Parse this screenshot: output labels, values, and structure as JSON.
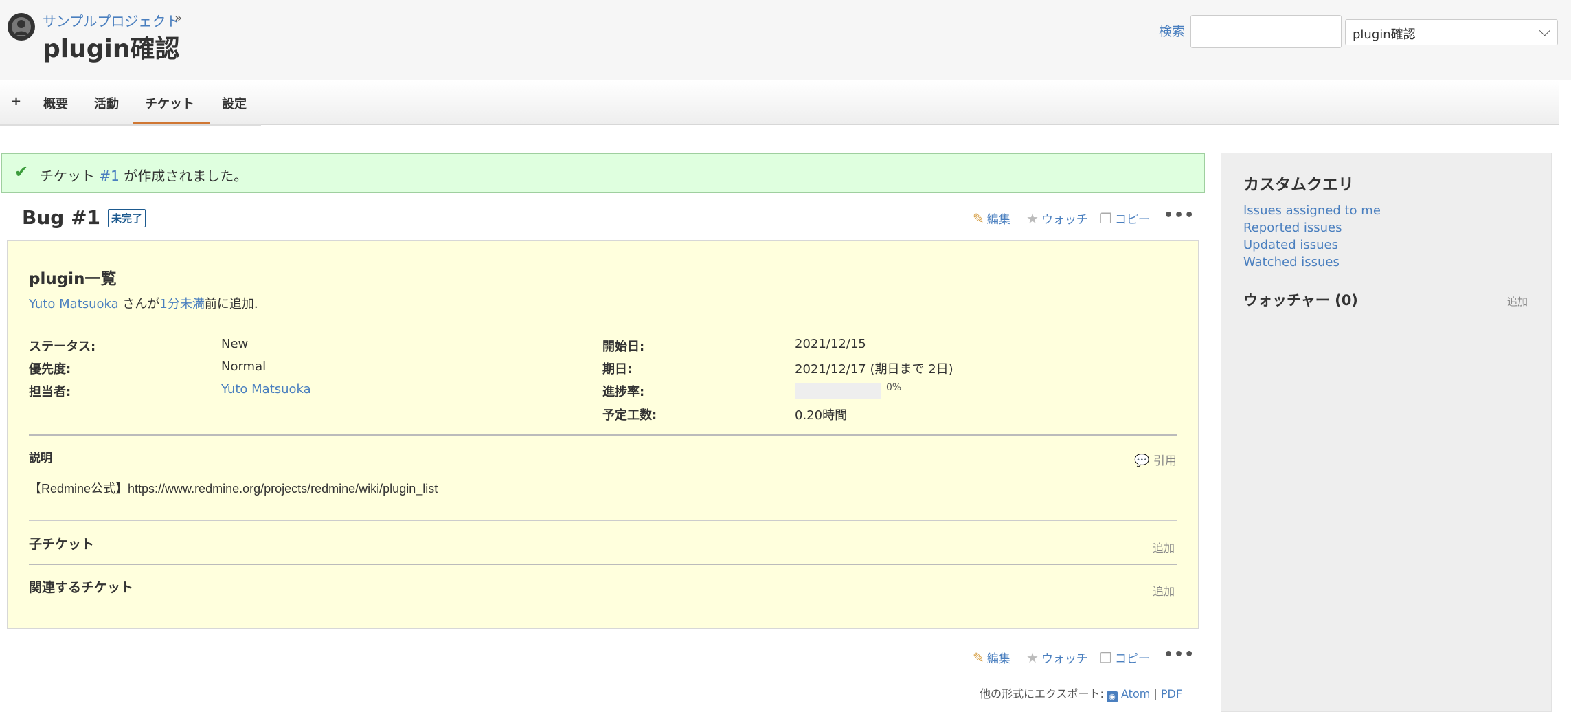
{
  "header": {
    "parent_project": "サンプルプロジェクト",
    "separator": "»",
    "title": "plugin確認",
    "search_label": "検索",
    "search_value": "",
    "project_select_value": "plugin確認"
  },
  "tabs": [
    {
      "label": "+"
    },
    {
      "label": "概要"
    },
    {
      "label": "活動"
    },
    {
      "label": "チケット",
      "selected": true
    },
    {
      "label": "設定"
    }
  ],
  "flash": {
    "prefix": "チケット ",
    "link": "#1",
    "suffix": " が作成されました。"
  },
  "issue": {
    "heading": "Bug #1",
    "status_badge": "未完了",
    "subject": "plugin一覧",
    "author": "Yuto Matsuoka",
    "author_mid": " さんが",
    "age": "1分未満",
    "age_suffix": "前に追加.",
    "attributes": {
      "status_label": "ステータス:",
      "status_value": "New",
      "priority_label": "優先度:",
      "priority_value": "Normal",
      "assignee_label": "担当者:",
      "assignee_value": "Yuto Matsuoka",
      "start_label": "開始日:",
      "start_value": "2021/12/15",
      "due_label": "期日:",
      "due_value": "2021/12/17 (期日まで 2日)",
      "progress_label": "進捗率:",
      "progress_value": "0%",
      "progress_fraction": 0,
      "estimate_label": "予定工数:",
      "estimate_value": "0.20時間"
    },
    "description_label": "説明",
    "quote_label": "引用",
    "description_text": "【Redmine公式】https://www.redmine.org/projects/redmine/wiki/plugin_list",
    "subtasks_label": "子チケット",
    "subtasks_add": "追加",
    "relations_label": "関連するチケット",
    "relations_add": "追加"
  },
  "actions": {
    "edit": "編集",
    "watch": "ウォッチ",
    "copy": "コピー",
    "more": "•••"
  },
  "export": {
    "label": "他の形式にエクスポート:",
    "atom": "Atom",
    "sep": "|",
    "pdf": "PDF"
  },
  "sidebar": {
    "title": "カスタムクエリ",
    "queries": [
      "Issues assigned to me",
      "Reported issues",
      "Updated issues",
      "Watched issues"
    ],
    "watchers_title": "ウォッチャー (0)",
    "watchers_add": "追加"
  },
  "colors": {
    "link": "#4a7fbf",
    "tab_selected_underline": "#d07733",
    "flash_bg": "#dfffdf",
    "issue_bg": "#ffffdd",
    "sidebar_bg": "#eeeeee"
  }
}
